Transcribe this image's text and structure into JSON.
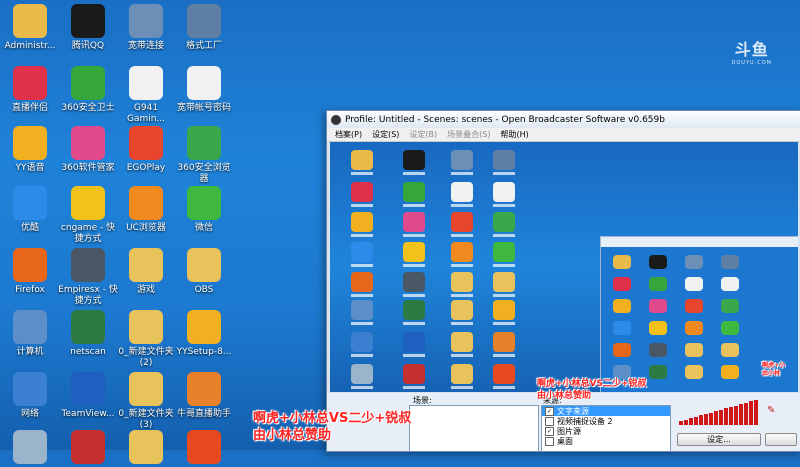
{
  "desktop_icons": [
    {
      "label": "Administr...",
      "color": "#e9b94a"
    },
    {
      "label": "腾讯QQ",
      "color": "#1a1a1a"
    },
    {
      "label": "宽带连接",
      "color": "#6c8fb8"
    },
    {
      "label": "格式工厂",
      "color": "#5f7ea3"
    },
    {
      "label": "直播伴侣",
      "color": "#e0304a"
    },
    {
      "label": "360安全卫士",
      "color": "#35a63a"
    },
    {
      "label": "G941 Gamin...",
      "color": "#f1f1f1"
    },
    {
      "label": "宽带帐号密码",
      "color": "#f1f1f1"
    },
    {
      "label": "YY语音",
      "color": "#f0b020"
    },
    {
      "label": "360软件管家",
      "color": "#e04a8c"
    },
    {
      "label": "EGOPlay",
      "color": "#e8452f"
    },
    {
      "label": "360安全浏览器",
      "color": "#3aa84a"
    },
    {
      "label": "优酷",
      "color": "#2c8ae8"
    },
    {
      "label": "cngame - 快捷方式",
      "color": "#f3c21a"
    },
    {
      "label": "UC浏览器",
      "color": "#f08a1e"
    },
    {
      "label": "微信",
      "color": "#3fb83f"
    },
    {
      "label": "Firefox",
      "color": "#e8661a"
    },
    {
      "label": "Empiresx - 快捷方式",
      "color": "#4a5866"
    },
    {
      "label": "游戏",
      "color": "#e8c25a"
    },
    {
      "label": "OBS",
      "color": "#e8c25a"
    },
    {
      "label": "计算机",
      "color": "#5c8fc8"
    },
    {
      "label": "netscan",
      "color": "#2c7a44"
    },
    {
      "label": "0_新建文件夹 (2)",
      "color": "#e8c25a"
    },
    {
      "label": "YYSetup-8...",
      "color": "#f0b020"
    },
    {
      "label": "网络",
      "color": "#3a7fd0"
    },
    {
      "label": "TeamView...",
      "color": "#1e5fc0"
    },
    {
      "label": "0_新建文件夹 (3)",
      "color": "#e8c25a"
    },
    {
      "label": "牛哥直播助手",
      "color": "#e8822a"
    },
    {
      "label": "",
      "color": "#9ab4cc"
    },
    {
      "label": "",
      "color": "#c63030"
    },
    {
      "label": "",
      "color": "#e8c25a"
    },
    {
      "label": "",
      "color": "#e84a20"
    }
  ],
  "watermark": {
    "brand": "斗鱼",
    "url": "DOUYU.COM"
  },
  "obs": {
    "title": "Profile: Untitled - Scenes: scenes - Open Broadcaster Software v0.659b",
    "menu": [
      "档案(P)",
      "设定(S)",
      "设定(B)",
      "场景叠合(S)",
      "帮助(H)"
    ],
    "scenes_label": "场景:",
    "sources_label": "来源:",
    "sources": [
      {
        "name": "文字来源",
        "checked": true,
        "selected": true
      },
      {
        "name": "视频捕捉设备 2",
        "checked": false,
        "selected": false
      },
      {
        "name": "图片源",
        "checked": true,
        "selected": false
      },
      {
        "name": "桌面",
        "checked": false,
        "selected": false
      }
    ],
    "settings_button": "设定..."
  },
  "overlay": {
    "line1": "啊虎+小林总VS二少+锐叔",
    "line2": "由小林总赞助"
  }
}
